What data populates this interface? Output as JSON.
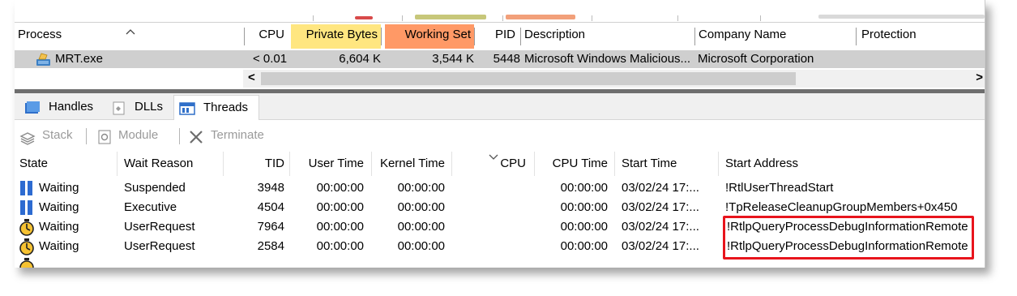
{
  "process_table": {
    "columns": {
      "process": "Process",
      "cpu": "CPU",
      "private_bytes": "Private Bytes",
      "working_set": "Working Set",
      "pid": "PID",
      "description": "Description",
      "company": "Company Name",
      "protection": "Protection"
    },
    "row": {
      "name": "MRT.exe",
      "cpu": "< 0.01",
      "private_bytes": "6,604 K",
      "working_set": "3,544 K",
      "pid": "5448",
      "description": "Microsoft Windows Malicious...",
      "company": "Microsoft Corporation"
    },
    "scroll_left": "<",
    "scroll_right": ">"
  },
  "colors": {
    "private_bytes_header": "#FFE680",
    "working_set_header": "#FF9966",
    "selected_row": "#CFCFCF",
    "highlight_box": "#E8141C"
  },
  "tabs": [
    {
      "label": "Handles",
      "icon": "handles-icon"
    },
    {
      "label": "DLLs",
      "icon": "dlls-icon"
    },
    {
      "label": "Threads",
      "icon": "threads-icon",
      "active": true
    }
  ],
  "actions": {
    "stack": "Stack",
    "module": "Module",
    "terminate": "Terminate"
  },
  "threads_table": {
    "columns": {
      "state": "State",
      "wait_reason": "Wait Reason",
      "tid": "TID",
      "user_time": "User Time",
      "kernel_time": "Kernel Time",
      "cpu": "CPU",
      "cpu_time": "CPU Time",
      "start_time": "Start Time",
      "start_address": "Start Address"
    },
    "rows": [
      {
        "state": "Waiting",
        "icon": "suspended-icon",
        "wait_reason": "Suspended",
        "tid": "3948",
        "user_time": "00:00:00",
        "kernel_time": "00:00:00",
        "cpu_time": "00:00:00",
        "start_time": "03/02/24 17:...",
        "start_address": "!RtlUserThreadStart"
      },
      {
        "state": "Waiting",
        "icon": "suspended-icon",
        "wait_reason": "Executive",
        "tid": "4504",
        "user_time": "00:00:00",
        "kernel_time": "00:00:00",
        "cpu_time": "00:00:00",
        "start_time": "03/02/24 17:...",
        "start_address": "!TpReleaseCleanupGroupMembers+0x450"
      },
      {
        "state": "Waiting",
        "icon": "stopwatch-icon",
        "wait_reason": "UserRequest",
        "tid": "7964",
        "user_time": "00:00:00",
        "kernel_time": "00:00:00",
        "cpu_time": "00:00:00",
        "start_time": "03/02/24 17:...",
        "start_address": "!RtlpQueryProcessDebugInformationRemote"
      },
      {
        "state": "Waiting",
        "icon": "stopwatch-icon",
        "wait_reason": "UserRequest",
        "tid": "2584",
        "user_time": "00:00:00",
        "kernel_time": "00:00:00",
        "cpu_time": "00:00:00",
        "start_time": "03/02/24 17:...",
        "start_address": "!RtlpQueryProcessDebugInformationRemote"
      }
    ]
  }
}
